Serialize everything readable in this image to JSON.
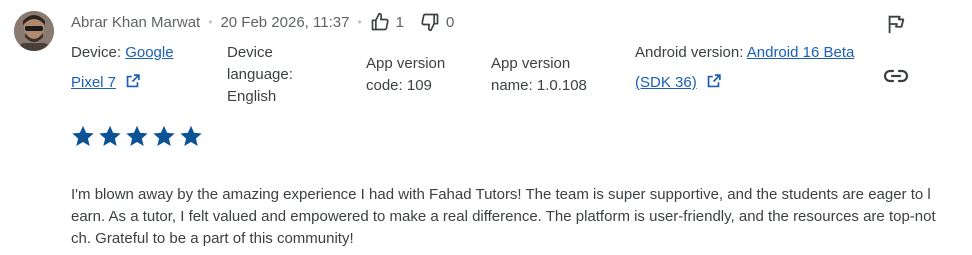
{
  "review": {
    "author": "Abrar Khan Marwat",
    "date": "20 Feb 2026, 11:37",
    "thumbs_up_count": "1",
    "thumbs_down_count": "0",
    "rating": 5,
    "rating_max": 5,
    "text": "I'm blown away by the amazing experience I had with Fahad Tutors! The team is super supportive, and the students are eager to learn. As a tutor, I felt valued and empowered to make a real difference. The platform is user-friendly, and the resources are top-notch. Grateful to be a part of this community!"
  },
  "meta": {
    "device_label": "Device:",
    "device_value_line1": "Google",
    "device_value_line2": "Pixel 7",
    "device_language_line1": "Device",
    "device_language_line2": "language:",
    "device_language_line3": "English",
    "app_version_code_line1": "App version",
    "app_version_code_line2": "code: 109",
    "app_version_name_line1": "App version",
    "app_version_name_line2": "name: 1.0.108",
    "android_label": "Android version:",
    "android_value_line1": "Android 16 Beta",
    "android_value_line2": "(SDK 36)"
  },
  "colors": {
    "star": "#0b5394",
    "link": "#1a5fb4",
    "text": "#3c4043",
    "muted": "#5f6368"
  },
  "icons": {
    "thumbs_up": "thumbs-up-icon",
    "thumbs_down": "thumbs-down-icon",
    "flag": "flag-icon",
    "link": "link-icon",
    "open_external": "open-external-icon"
  }
}
